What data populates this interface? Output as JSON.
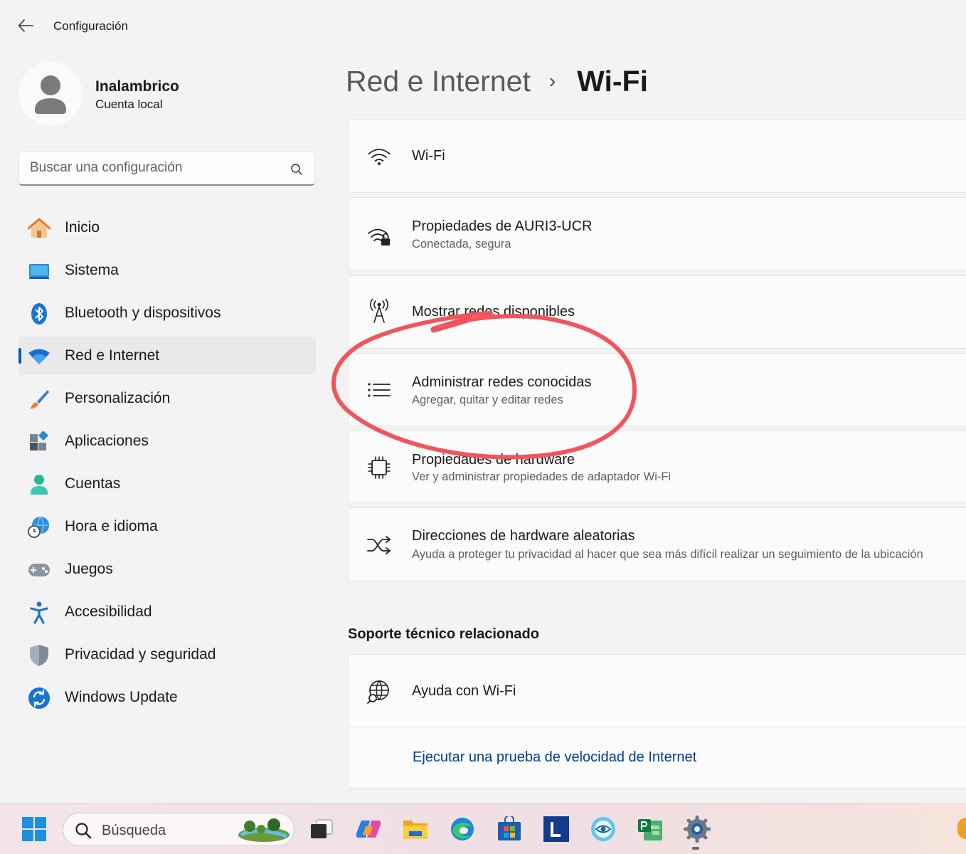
{
  "window": {
    "title": "Configuración"
  },
  "profile": {
    "name": "Inalambrico",
    "account_type": "Cuenta local"
  },
  "search": {
    "placeholder": "Buscar una configuración"
  },
  "nav": {
    "items": [
      {
        "label": "Inicio",
        "icon": "home-icon"
      },
      {
        "label": "Sistema",
        "icon": "system-icon"
      },
      {
        "label": "Bluetooth y dispositivos",
        "icon": "bluetooth-icon"
      },
      {
        "label": "Red e Internet",
        "icon": "network-icon",
        "active": true
      },
      {
        "label": "Personalización",
        "icon": "brush-icon"
      },
      {
        "label": "Aplicaciones",
        "icon": "apps-icon"
      },
      {
        "label": "Cuentas",
        "icon": "accounts-icon"
      },
      {
        "label": "Hora e idioma",
        "icon": "time-language-icon"
      },
      {
        "label": "Juegos",
        "icon": "gamepad-icon"
      },
      {
        "label": "Accesibilidad",
        "icon": "accessibility-icon"
      },
      {
        "label": "Privacidad y seguridad",
        "icon": "shield-icon"
      },
      {
        "label": "Windows Update",
        "icon": "windows-update-icon"
      }
    ]
  },
  "breadcrumb": {
    "parent": "Red e Internet",
    "separator": "›",
    "current": "Wi-Fi"
  },
  "cards": [
    {
      "title": "Wi-Fi",
      "icon": "wifi-icon"
    },
    {
      "title": "Propiedades de AURI3-UCR",
      "subtitle": "Conectada, segura",
      "icon": "wifi-lock-icon"
    },
    {
      "title": "Mostrar redes disponibles",
      "icon": "antenna-icon"
    },
    {
      "title": "Administrar redes conocidas",
      "subtitle": "Agregar, quitar y editar redes",
      "icon": "list-icon"
    },
    {
      "title": "Propiedades de hardware",
      "subtitle": "Ver y administrar propiedades de adaptador Wi-Fi",
      "icon": "chip-icon"
    },
    {
      "title": "Direcciones de hardware aleatorias",
      "subtitle": "Ayuda a proteger tu privacidad al hacer que sea más difícil realizar un seguimiento de la ubicación",
      "icon": "shuffle-icon"
    }
  ],
  "support": {
    "title": "Soporte técnico relacionado",
    "help_title": "Ayuda con Wi-Fi",
    "help_icon": "globe-search-icon",
    "link": "Ejecutar una prueba de velocidad de Internet"
  },
  "annotation": {
    "color": "#f2545b",
    "target": "Administrar redes conocidas"
  },
  "taskbar": {
    "search_text": "Búsqueda",
    "apps": [
      "windows-start-icon",
      "task-view-icon",
      "copilot-icon",
      "file-explorer-icon",
      "edge-icon",
      "store-icon",
      "l-app-icon",
      "eye-app-icon",
      "project-icon",
      "settings-icon"
    ]
  },
  "colors": {
    "accent": "#005fb8",
    "link": "#003e92",
    "annotation": "#f2545b"
  }
}
